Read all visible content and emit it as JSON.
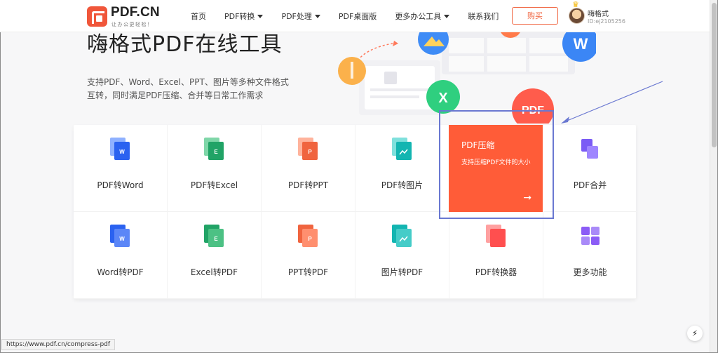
{
  "header": {
    "logo_text": "PDF.CN",
    "logo_sub": "让办公更轻松！",
    "nav": [
      {
        "label": "首页",
        "dropdown": false
      },
      {
        "label": "PDF转换",
        "dropdown": true
      },
      {
        "label": "PDF处理",
        "dropdown": true
      },
      {
        "label": "PDF桌面版",
        "dropdown": false
      },
      {
        "label": "更多办公工具",
        "dropdown": true
      },
      {
        "label": "联系我们",
        "dropdown": false
      }
    ],
    "buy_label": "购买",
    "user_name": "嗨格式",
    "user_id": "ID:ej2105256"
  },
  "hero": {
    "title": "嗨格式PDF在线工具",
    "desc_line1": "支持PDF、Word、Excel、PPT、图片等多种文件格式",
    "desc_line2": "互转，同时满足PDF压缩、合并等日常工作需求"
  },
  "tools_row1": [
    {
      "label": "PDF转Word",
      "icon": "word-file-icon",
      "color": "#2b62f0"
    },
    {
      "label": "PDF转Excel",
      "icon": "excel-file-icon",
      "color": "#21a366"
    },
    {
      "label": "PDF转PPT",
      "icon": "ppt-file-icon",
      "color": "#f0643f"
    },
    {
      "label": "PDF转图片",
      "icon": "image-file-icon",
      "color": "#13b5b1"
    },
    {
      "label": "PDF压缩",
      "icon": "compress-icon",
      "color": "#ff5c38"
    },
    {
      "label": "PDF合并",
      "icon": "merge-icon",
      "color": "#7b5cf5"
    }
  ],
  "tools_row2": [
    {
      "label": "Word转PDF",
      "icon": "word-file-icon",
      "color": "#2b62f0"
    },
    {
      "label": "Excel转PDF",
      "icon": "excel-file-icon",
      "color": "#21a366"
    },
    {
      "label": "PPT转PDF",
      "icon": "ppt-file-icon",
      "color": "#f0643f"
    },
    {
      "label": "图片转PDF",
      "icon": "image-file-icon",
      "color": "#13b5b1"
    },
    {
      "label": "PDF转换器",
      "icon": "converter-icon",
      "color": "#ff4f4f"
    },
    {
      "label": "更多功能",
      "icon": "grid-more-icon",
      "color": "#8b5cf6"
    }
  ],
  "feature": {
    "title": "PDF压缩",
    "desc": "支持压缩PDF文件的大小",
    "arrow": "→"
  },
  "illustration": {
    "bubble_w": "W",
    "bubble_x": "X",
    "bubble_pdf": "PDF"
  },
  "status_url": "https://www.pdf.cn/compress-pdf",
  "float_icon": "⚡"
}
